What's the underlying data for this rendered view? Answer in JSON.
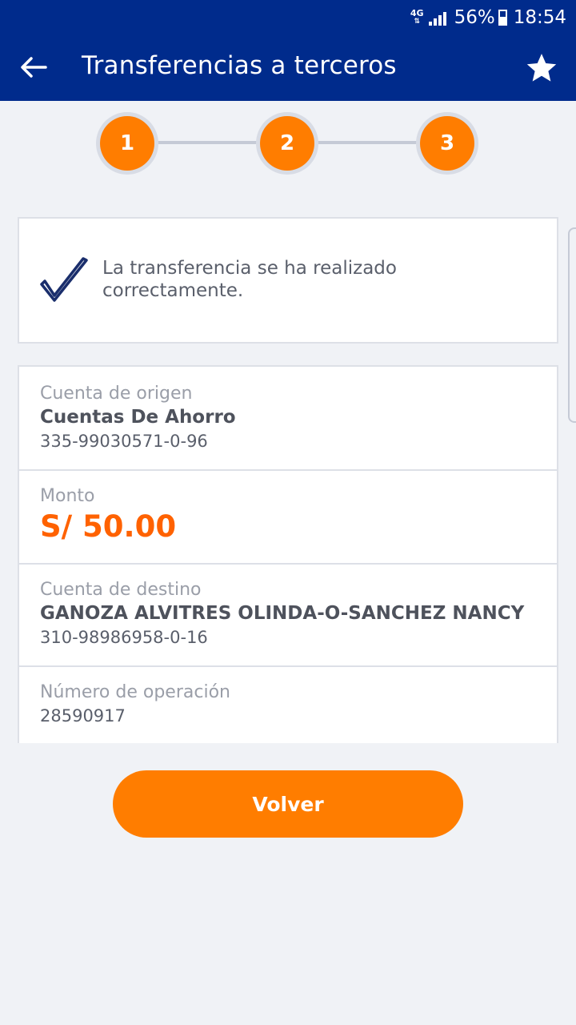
{
  "status_bar": {
    "network": "4G",
    "battery": "56%",
    "time": "18:54"
  },
  "header": {
    "title": "Transferencias a terceros",
    "back_icon": "arrow-left-icon",
    "favorite_icon": "star-icon"
  },
  "stepper": {
    "steps": [
      "1",
      "2",
      "3"
    ],
    "current_step": 3
  },
  "success": {
    "icon": "checkmark-icon",
    "message": "La transferencia se ha realizado correctamente."
  },
  "details": {
    "origin": {
      "label": "Cuenta de origen",
      "name": "Cuentas De Ahorro",
      "number": "335-99030571-0-96"
    },
    "amount": {
      "label": "Monto",
      "value": "S/ 50.00"
    },
    "destination": {
      "label": "Cuenta de destino",
      "name": "GANOZA ALVITRES OLINDA-O-SANCHEZ NANCY",
      "number": "310-98986958-0-16"
    },
    "operation": {
      "label": "Número de operación",
      "value": "28590917"
    }
  },
  "actions": {
    "back_label": "Volver"
  },
  "colors": {
    "primary": "#002b8c",
    "accent": "#ff7d00",
    "amount": "#ff6200"
  }
}
